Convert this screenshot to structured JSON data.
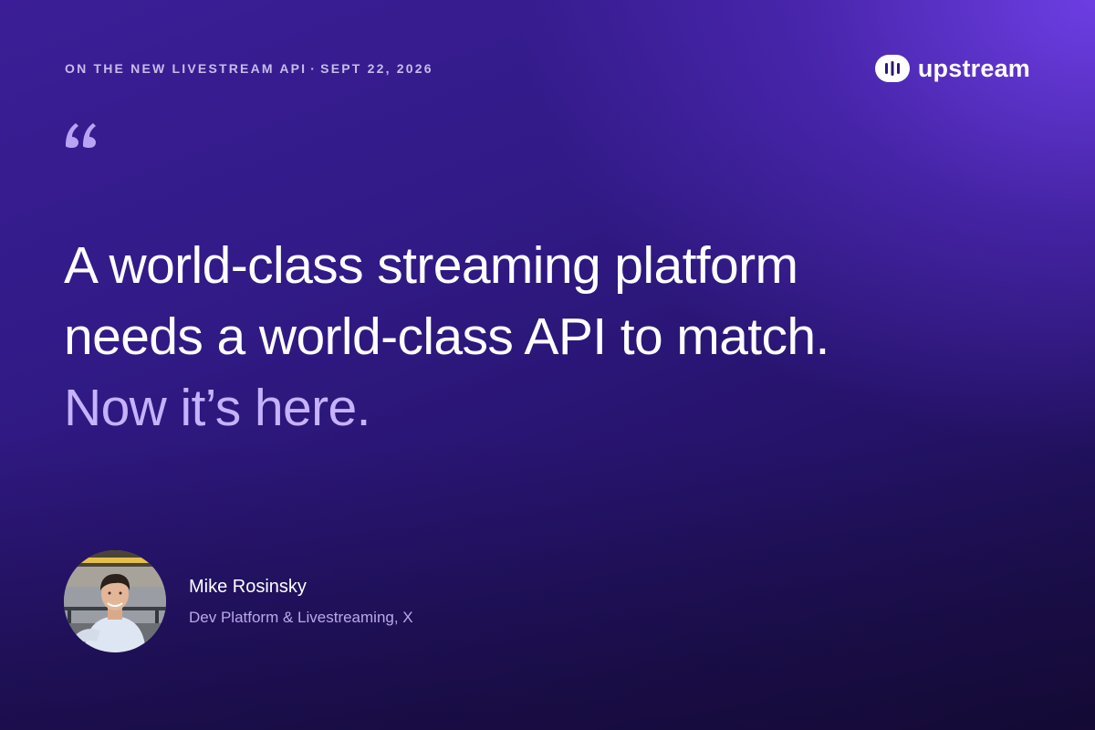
{
  "eyebrow": {
    "topic": "ON THE NEW LIVESTREAM API",
    "separator": "·",
    "date": "SEPT 22, 2026"
  },
  "brand": {
    "name": "upstream",
    "icon": "upstream-logo-icon"
  },
  "quote": {
    "mark_icon": "quotation-mark-icon",
    "line_1": "A world-class streaming platform",
    "line_2": "needs a world-class API to match.",
    "highlight": "Now it’s here."
  },
  "author": {
    "name": "Mike Rosinsky",
    "role": "Dev Platform & Livestreaming, X",
    "avatar_icon": "person-photo-avatar"
  },
  "colors": {
    "background_top": "#3b1e97",
    "background_bottom": "#170c3f",
    "accent_glow": "#7040e8",
    "highlight_text": "#c6b2ff",
    "eyebrow_text": "#c7bde8",
    "role_text": "#b9a9e8"
  }
}
